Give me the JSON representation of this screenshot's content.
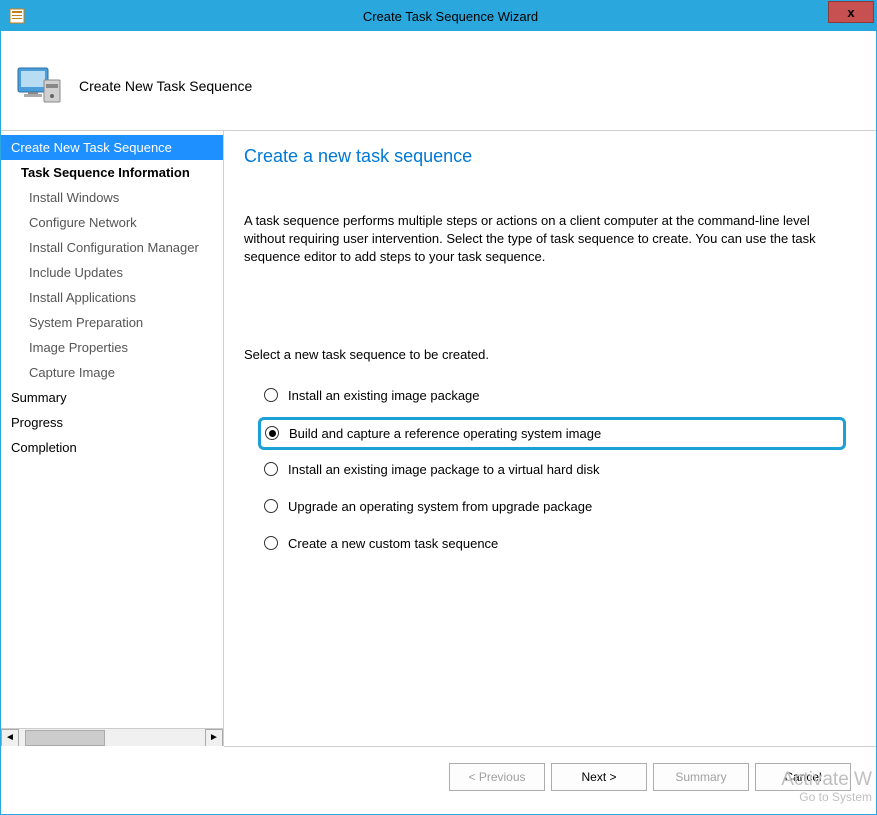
{
  "window": {
    "title": "Create Task Sequence Wizard",
    "close_icon": "x"
  },
  "header": {
    "title": "Create New Task Sequence"
  },
  "sidebar": {
    "items": [
      {
        "label": "Create New Task Sequence",
        "selected": true,
        "indent": 0,
        "bold": false
      },
      {
        "label": "Task Sequence Information",
        "selected": false,
        "indent": 1,
        "bold": true
      },
      {
        "label": "Install Windows",
        "selected": false,
        "indent": 2,
        "bold": false
      },
      {
        "label": "Configure Network",
        "selected": false,
        "indent": 2,
        "bold": false
      },
      {
        "label": "Install Configuration Manager",
        "selected": false,
        "indent": 2,
        "bold": false
      },
      {
        "label": "Include Updates",
        "selected": false,
        "indent": 2,
        "bold": false
      },
      {
        "label": "Install Applications",
        "selected": false,
        "indent": 2,
        "bold": false
      },
      {
        "label": "System Preparation",
        "selected": false,
        "indent": 2,
        "bold": false
      },
      {
        "label": "Image Properties",
        "selected": false,
        "indent": 2,
        "bold": false
      },
      {
        "label": "Capture Image",
        "selected": false,
        "indent": 2,
        "bold": false
      },
      {
        "label": "Summary",
        "selected": false,
        "indent": 0,
        "bold": false
      },
      {
        "label": "Progress",
        "selected": false,
        "indent": 0,
        "bold": false
      },
      {
        "label": "Completion",
        "selected": false,
        "indent": 0,
        "bold": false
      }
    ]
  },
  "main": {
    "heading": "Create a new task sequence",
    "description": "A task sequence performs multiple steps or actions on a client computer at the command-line level without requiring user intervention. Select the type of task sequence to create. You can use the task sequence editor to add steps to your task sequence.",
    "subheading": "Select a new task sequence to be created.",
    "options": [
      {
        "label": "Install an existing image package",
        "checked": false,
        "highlighted": false
      },
      {
        "label": "Build and capture a reference operating system image",
        "checked": true,
        "highlighted": true
      },
      {
        "label": "Install an existing image package to a virtual hard disk",
        "checked": false,
        "highlighted": false
      },
      {
        "label": "Upgrade an operating system from upgrade package",
        "checked": false,
        "highlighted": false
      },
      {
        "label": "Create a new custom task sequence",
        "checked": false,
        "highlighted": false
      }
    ]
  },
  "footer": {
    "previous": "< Previous",
    "next": "Next >",
    "summary": "Summary",
    "cancel": "Cancel"
  },
  "watermark": {
    "line1": "Activate W",
    "line2": "Go to System"
  }
}
